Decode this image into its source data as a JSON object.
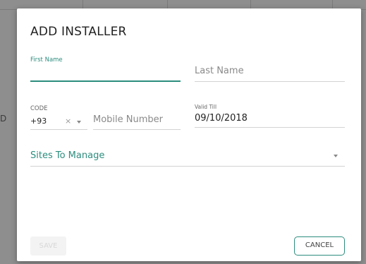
{
  "background": {
    "partial_text": "D"
  },
  "dialog": {
    "title": "ADD INSTALLER",
    "first_name": {
      "label": "First Name",
      "value": ""
    },
    "last_name": {
      "placeholder": "Last Name"
    },
    "code": {
      "label": "CODE",
      "value": "+93",
      "clear": "×"
    },
    "mobile": {
      "placeholder": "Mobile Number"
    },
    "valid_till": {
      "label": "Valid Till",
      "value": "09/10/2018"
    },
    "sites": {
      "label": "Sites To Manage"
    },
    "buttons": {
      "save": "SAVE",
      "cancel": "CANCEL"
    }
  },
  "colors": {
    "accent": "#2c8d7e",
    "backdrop": "#8e8e8e"
  }
}
